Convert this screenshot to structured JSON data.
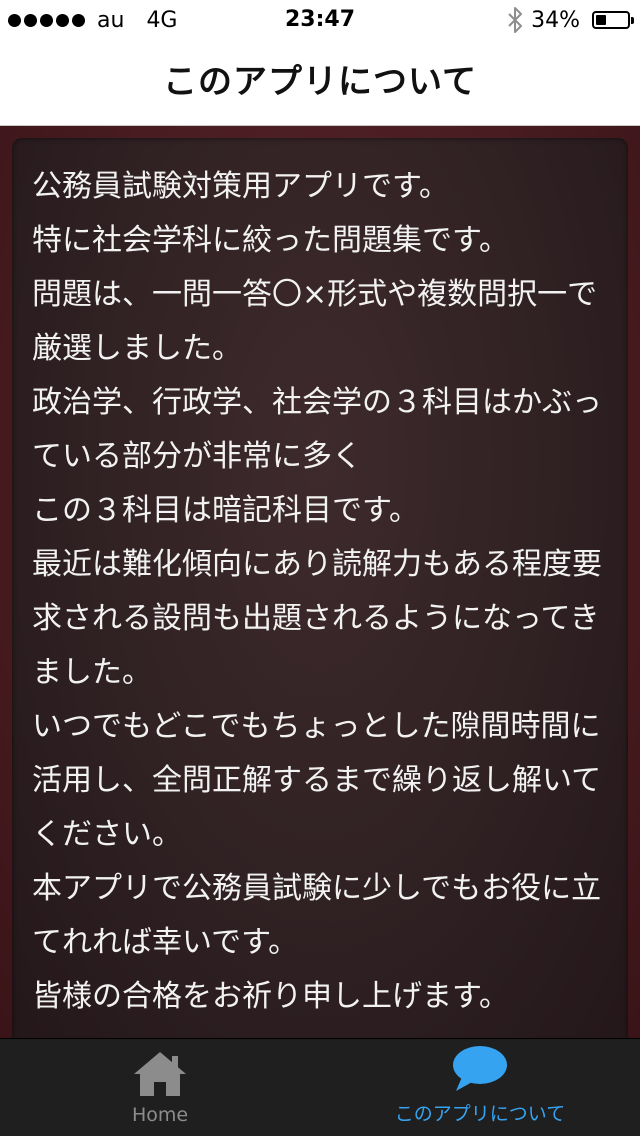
{
  "status_bar": {
    "carrier": "au",
    "network": "4G",
    "time": "23:47",
    "battery_text": "34%",
    "battery_level": 0.34,
    "signal_bars": 5
  },
  "nav": {
    "title": "このアプリについて"
  },
  "content": {
    "text": "公務員試験対策用アプリです。\n特に社会学科に絞った問題集です。\n問題は、一問一答〇×形式や複数問択一で厳選しました。\n政治学、行政学、社会学の３科目はかぶっている部分が非常に多く\nこの３科目は暗記科目です。\n最近は難化傾向にあり読解力もある程度要求される設問も出題されるようになってきました。\nいつでもどこでもちょっとした隙間時間に活用し、全問正解するまで繰り返し解いてください。\n本アプリで公務員試験に少しでもお役に立てれれば幸いです。\n皆様の合格をお祈り申し上げます。"
  },
  "tab_bar": {
    "tabs": [
      {
        "label": "Home",
        "icon": "home-icon",
        "active": false
      },
      {
        "label": "このアプリについて",
        "icon": "speech-bubble-icon",
        "active": true
      }
    ]
  },
  "colors": {
    "accent": "#36a3f0",
    "tab_bar_bg": "#1f1f1f",
    "content_bg": "#2e2022",
    "frame_bg": "#4a1d22",
    "text": "#f2f2f2"
  }
}
